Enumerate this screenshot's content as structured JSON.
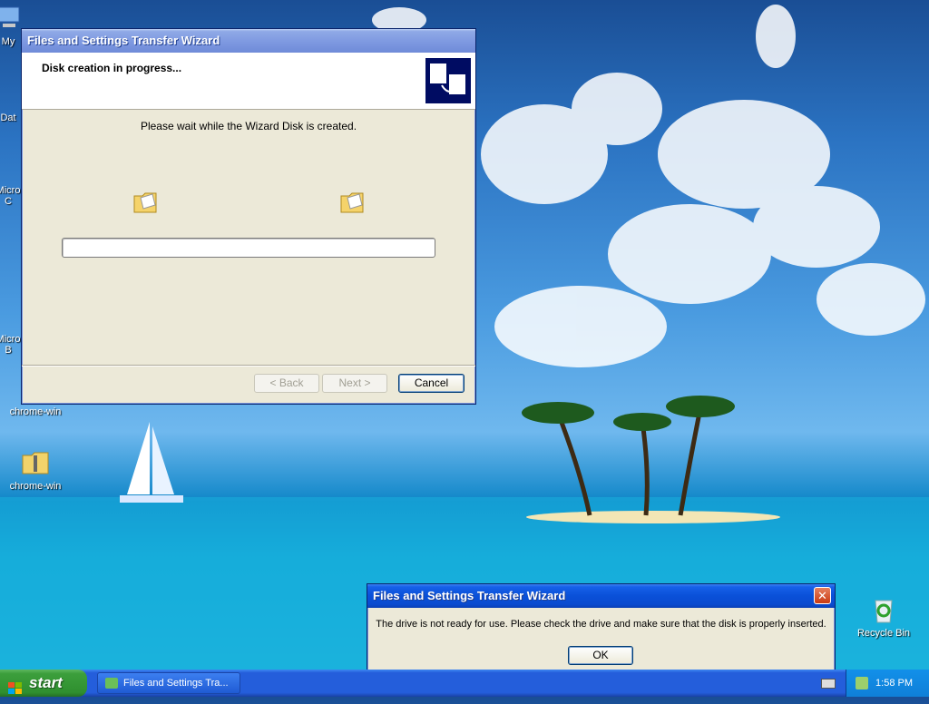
{
  "desktop": {
    "icons": [
      {
        "label": "My",
        "icon": "computer-icon"
      },
      {
        "label": "Dat",
        "icon": "database-icon"
      },
      {
        "label": "Micro",
        "icon": "app-icon"
      },
      {
        "label": "C",
        "icon": "app-icon"
      },
      {
        "label": "Micro",
        "icon": "app-icon"
      },
      {
        "label": "B",
        "icon": "app-icon"
      },
      {
        "label": "chrome-win",
        "icon": "folder-icon"
      },
      {
        "label": "chrome-win",
        "icon": "zip-folder-icon"
      },
      {
        "label": "Recycle Bin",
        "icon": "recycle-bin-icon"
      }
    ]
  },
  "wizard": {
    "title": "Files and Settings Transfer Wizard",
    "header": "Disk creation in progress...",
    "message": "Please wait while the Wizard Disk is created.",
    "progress": 0,
    "back_label": "< Back",
    "next_label": "Next >",
    "cancel_label": "Cancel"
  },
  "alert": {
    "title": "Files and Settings Transfer Wizard",
    "message": "The drive is not ready for use. Please check the drive and make sure that the disk is properly inserted.",
    "ok_label": "OK"
  },
  "taskbar": {
    "start_label": "start",
    "task_label": "Files and Settings Tra...",
    "clock": "1:58 PM"
  },
  "colors": {
    "accent": "#0a50d8",
    "start_green": "#3c9f3c",
    "close_red": "#c93a12"
  }
}
